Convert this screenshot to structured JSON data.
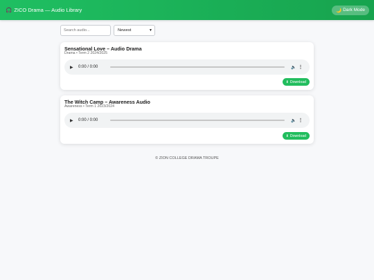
{
  "header": {
    "title": "ZICO Drama — Audio Library",
    "dark_mode_label": "Dark Mode"
  },
  "controls": {
    "search_placeholder": "Search audio...",
    "sort_selected": "Newest"
  },
  "cards": [
    {
      "title": "Sensational Love – Audio Drama",
      "meta": "Drama • Term 2 2024/2025",
      "player_time": "0:00 / 0:00",
      "download_label": "Download"
    },
    {
      "title": "The Witch Camp – Awareness Audio",
      "meta": "Awareness • Term 1 2023/2024",
      "player_time": "0:00 / 0:00",
      "download_label": "Download"
    }
  ],
  "footer": {
    "text": "© ZION COLLEGE DRAMA TROUPE"
  },
  "icons": {
    "title_icon": "headphones-icon",
    "dark_mode_icon": "moon-icon",
    "download_icon": "download-icon"
  },
  "colors": {
    "header": "#1fbf62",
    "accent": "#22bd5e",
    "background": "#f7f8fa"
  }
}
